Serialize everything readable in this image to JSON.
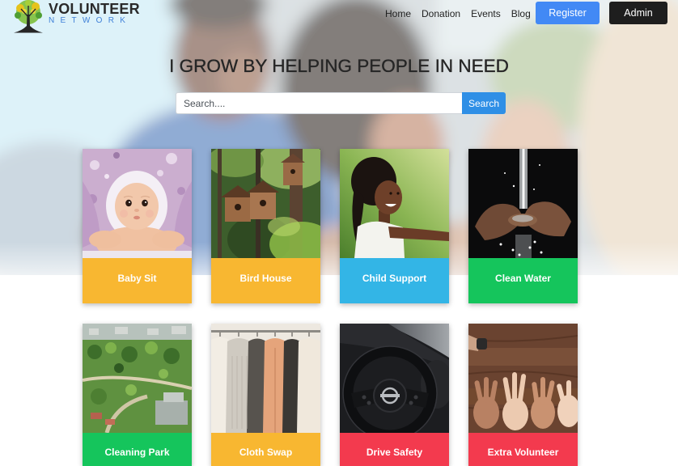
{
  "brand": {
    "name": "VOLUNTEER",
    "tagline": "NETWORK",
    "logo_icon": "tree-icon",
    "tagline_color": "#3f80d8"
  },
  "nav": {
    "items": [
      {
        "label": "Home"
      },
      {
        "label": "Donation"
      },
      {
        "label": "Events"
      },
      {
        "label": "Blog"
      }
    ]
  },
  "actions": {
    "register": {
      "label": "Register",
      "color": "#4289f5"
    },
    "admin": {
      "label": "Admin",
      "color": "#1e1e1e"
    }
  },
  "hero": {
    "title": "I GROW BY HELPING PEOPLE IN NEED",
    "background": "hero-people-photo"
  },
  "search": {
    "placeholder": "Search....",
    "button_label": "Search",
    "button_color": "#2f8fe6"
  },
  "categories": [
    {
      "label": "Baby Sit",
      "color": "#f8b731",
      "image": "baby-photo"
    },
    {
      "label": "Bird House",
      "color": "#f8b731",
      "image": "birdhouse-photo"
    },
    {
      "label": "Child Support",
      "color": "#33b5e6",
      "image": "child-photo"
    },
    {
      "label": "Clean Water",
      "color": "#15c55c",
      "image": "water-hands-photo"
    },
    {
      "label": "Cleaning Park",
      "color": "#15c55c",
      "image": "park-aerial-photo"
    },
    {
      "label": "Cloth Swap",
      "color": "#f8b731",
      "image": "clothes-rack-photo"
    },
    {
      "label": "Drive Safety",
      "color": "#f33a4e",
      "image": "steering-wheel-photo"
    },
    {
      "label": "Extra Volunteer",
      "color": "#f33a4e",
      "image": "hands-on-table-photo"
    }
  ]
}
